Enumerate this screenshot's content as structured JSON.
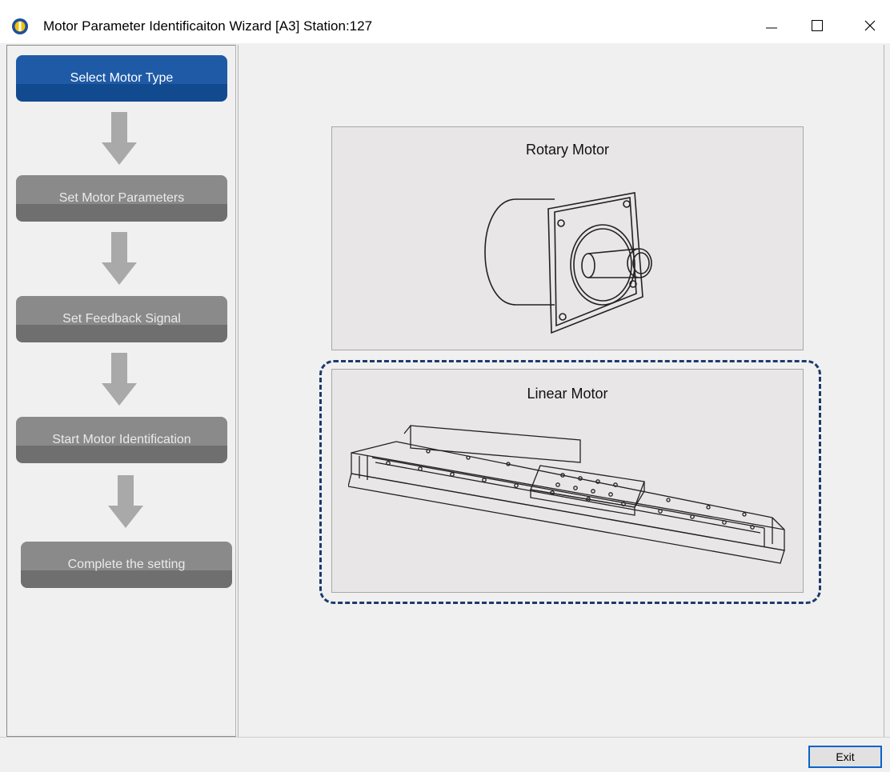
{
  "window": {
    "title": "Motor Parameter Identificaiton Wizard [A3] Station:127"
  },
  "steps": [
    {
      "label": "Select Motor Type",
      "state": "active"
    },
    {
      "label": "Set Motor Parameters",
      "state": "inactive"
    },
    {
      "label": "Set Feedback Signal",
      "state": "inactive"
    },
    {
      "label": "Start Motor Identification",
      "state": "inactive"
    },
    {
      "label": "Complete the setting",
      "state": "inactive"
    }
  ],
  "motors": {
    "rotary": {
      "label": "Rotary Motor",
      "icon": "rotary-motor-illustration"
    },
    "linear": {
      "label": "Linear Motor",
      "icon": "linear-motor-illustration",
      "selected": true
    }
  },
  "footer": {
    "exit_label": "Exit"
  },
  "colors": {
    "active_step": "#1e5aa6",
    "inactive_step": "#8a8a8a",
    "selection_outline": "#1c3a6e",
    "exit_border": "#0a64c8"
  }
}
